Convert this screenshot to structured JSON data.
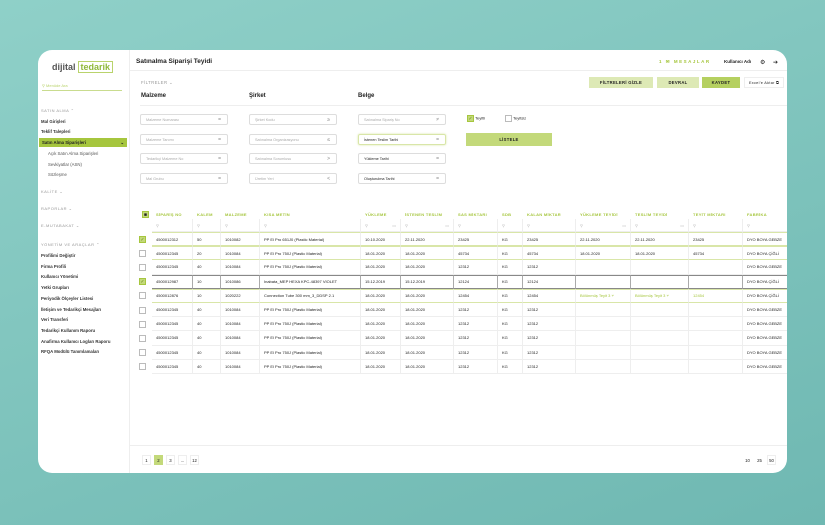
{
  "app": {
    "logo_left": "dijital",
    "logo_right": "tedarik",
    "title": "Satınalma Siparişi Teyidi"
  },
  "header": {
    "message_count": "1",
    "messages": "MESAJLAR",
    "user": "Kullanıcı Adı"
  },
  "sidebar": {
    "search_placeholder": "Menüde Ara",
    "sections": [
      {
        "label": "SATIN ALMA"
      },
      {
        "label": "KALİTE"
      },
      {
        "label": "RAPORLAR"
      },
      {
        "label": "E-MUTABAKAT"
      },
      {
        "label": "YÖNETİM VE ARAÇLAR"
      }
    ],
    "satin_alma": [
      "Mal Girişleri",
      "Teklif Talepleri",
      "Satın Alma Siparişleri"
    ],
    "sub": [
      "Açık Satın Alma Siparişleri",
      "Sevkiyatlar (ASN)",
      "Sözleşme"
    ],
    "yonetim": [
      "Profilimi Değiştir",
      "Firma Profili",
      "Kullanıcı Yönetimi",
      "Yetki Grupları",
      "Periyodik Ölçeyler Listesi",
      "İletişim ve Tedarikçi Mesajları",
      "Veri Transferi",
      "Tedarikçi Kullanım Raporu",
      "Anafirma Kullanıcı Logları Raporu",
      "RFQA Modülü Tanımlamaları"
    ]
  },
  "filters": {
    "toggle": "FİLTRELER",
    "columns": [
      "Malzeme",
      "Şirket",
      "Belge"
    ],
    "malzeme": [
      {
        "p": "Malzeme Numarası",
        "op": "="
      },
      {
        "p": "Malzeme Tanımı",
        "op": "="
      },
      {
        "p": "Tedarikçi Malzeme No",
        "op": "="
      },
      {
        "p": "Mal Grubu",
        "op": "="
      }
    ],
    "sirket": [
      {
        "p": "Şirket Kodu",
        "op": "≥"
      },
      {
        "p": "Satınalma Organizasyonu",
        "op": "≤"
      },
      {
        "p": "Satınalma Sorumlusu",
        "op": ">"
      },
      {
        "p": "Üretim Yeri",
        "op": "<"
      }
    ],
    "belge": [
      {
        "p": "Satınalma Sipariş No",
        "op": "≠"
      },
      {
        "p": "İstenen Teslim Tarihi",
        "op": "="
      },
      {
        "p": "Yükleme Tarihi",
        "op": "="
      },
      {
        "p": "Oluşturulma Tarihi",
        "op": "="
      }
    ],
    "teyitli": "Teyitli",
    "teyitsiz": "Teyitsiz",
    "list_button": "LİSTELE"
  },
  "toolbar": {
    "hide_filters": "FİLTRELERİ GİZLE",
    "devral": "DEVRAL",
    "kaydet": "KAYDET",
    "excel": "Excel'e Aktar"
  },
  "colors": {
    "accent": "#a6c63e",
    "accent_light": "#d9e6a8"
  },
  "table": {
    "columns": [
      "SİPARİŞ NO",
      "KALEM",
      "MALZEME",
      "KISA METİN",
      "YÜKLEME",
      "İSTENEN TESLİM",
      "SAS MİKTARI",
      "SDB",
      "KALAN MİKTAR",
      "YÜKLEME TEYİDİ",
      "TESLİM TEYİDİ",
      "TEYİT MİKTARI",
      "FABRİKA"
    ],
    "rows": [
      {
        "checked": true,
        "style": "green",
        "cells": [
          "4500012312",
          "50",
          "1010082",
          "PP El Pro 651J0 (Plastic Material)",
          "10.10.2020",
          "22.11.2020",
          "23425",
          "KG",
          "23425",
          "22.11.2020",
          "22.11.2020",
          "23425",
          "DYO BOYA GEBZE"
        ]
      },
      {
        "checked": false,
        "style": "green",
        "cells": [
          "4500012345",
          "20",
          "1010084",
          "PP El Pro 750J (Plastic Material)",
          "18.01.2020",
          "18.01.2020",
          "45734",
          "KG",
          "45734",
          "18.01.2020",
          "18.01.2020",
          "45734",
          "DYO BOYA ÇİĞLİ"
        ]
      },
      {
        "checked": false,
        "style": "",
        "cells": [
          "4500012345",
          "40",
          "1010084",
          "PP El Pro 750J (Plastic Material)",
          "18.01.2020",
          "18.01.2020",
          "12312",
          "KG",
          "12312",
          "",
          "",
          "",
          "DYO BOYA GEBZE"
        ]
      },
      {
        "checked": true,
        "style": "sel",
        "cells": [
          "4500012987",
          "10",
          "1010086",
          "Inabata_MEP HEXA KPC-48397 VIOLET",
          "15.12.2019",
          "15.12.2019",
          "12124",
          "KG",
          "12124",
          "",
          "",
          "",
          "DYO BOYA ÇİĞLİ"
        ]
      },
      {
        "checked": false,
        "style": "green",
        "split": true,
        "cells": [
          "4500012876",
          "10",
          "1020222",
          "Connection Tube 300 mm_3_DDSP 2.1",
          "18.01.2020",
          "18.01.2020",
          "12454",
          "KG",
          "12454",
          "Bölünmüş Teyit 3",
          "Bölünmüş Teyit 3",
          "12454",
          "DYO BOYA ÇİĞLİ"
        ]
      },
      {
        "checked": false,
        "style": "",
        "cells": [
          "4500012345",
          "40",
          "1010084",
          "PP El Pro 750J (Plastic Material)",
          "18.01.2020",
          "18.01.2020",
          "12312",
          "KG",
          "12312",
          "",
          "",
          "",
          "DYO BOYA GEBZE"
        ]
      },
      {
        "checked": false,
        "style": "",
        "cells": [
          "4500012345",
          "40",
          "1010084",
          "PP El Pro 750J (Plastic Material)",
          "18.01.2020",
          "18.01.2020",
          "12312",
          "KG",
          "12312",
          "",
          "",
          "",
          "DYO BOYA GEBZE"
        ]
      },
      {
        "checked": false,
        "style": "",
        "cells": [
          "4500012345",
          "40",
          "1010084",
          "PP El Pro 750J (Plastic Material)",
          "18.01.2020",
          "18.01.2020",
          "12312",
          "KG",
          "12312",
          "",
          "",
          "",
          "DYO BOYA GEBZE"
        ]
      },
      {
        "checked": false,
        "style": "",
        "cells": [
          "4500012345",
          "40",
          "1010084",
          "PP El Pro 750J (Plastic Material)",
          "18.01.2020",
          "18.01.2020",
          "12312",
          "KG",
          "12312",
          "",
          "",
          "",
          "DYO BOYA GEBZE"
        ]
      },
      {
        "checked": false,
        "style": "",
        "cells": [
          "4500012345",
          "40",
          "1010084",
          "PP El Pro 750J (Plastic Material)",
          "18.01.2020",
          "18.01.2020",
          "12312",
          "KG",
          "12312",
          "",
          "",
          "",
          "DYO BOYA GEBZE"
        ]
      }
    ]
  },
  "pagination": {
    "pages": [
      "1",
      "2",
      "3",
      "...",
      "12"
    ],
    "current": "2",
    "page_sizes": [
      "10",
      "25",
      "50"
    ],
    "selected_size": "50"
  }
}
